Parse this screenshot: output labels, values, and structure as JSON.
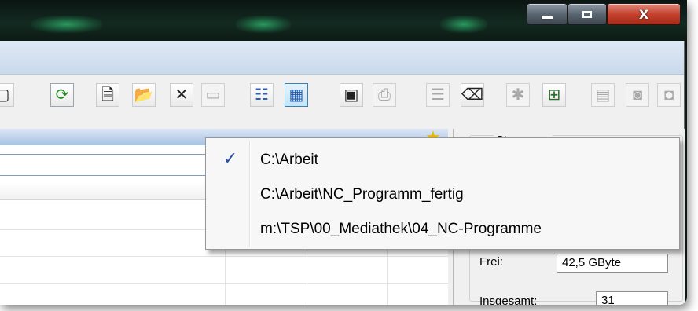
{
  "toolbar": {
    "buttons": [
      {
        "icon": "favorites-icon",
        "glyph": "▢",
        "state": "enabled"
      },
      {
        "icon": "refresh-icon",
        "glyph": "⟳",
        "state": "enabled"
      },
      {
        "icon": "new-file-icon",
        "glyph": "🗎",
        "state": "enabled"
      },
      {
        "icon": "open-folder-icon",
        "glyph": "📂",
        "state": "enabled"
      },
      {
        "icon": "delete-icon",
        "glyph": "✕",
        "state": "enabled"
      },
      {
        "icon": "rename-icon",
        "glyph": "▭",
        "state": "disabled"
      },
      {
        "icon": "list-view-icon",
        "glyph": "☷",
        "state": "enabled"
      },
      {
        "icon": "details-view-icon",
        "glyph": "▦",
        "state": "selected"
      },
      {
        "icon": "console-icon",
        "glyph": "▣",
        "state": "enabled"
      },
      {
        "icon": "print-icon",
        "glyph": "⎙",
        "state": "disabled"
      },
      {
        "icon": "document-list-icon",
        "glyph": "☰",
        "state": "disabled"
      },
      {
        "icon": "eraser-icon",
        "glyph": "⌫",
        "state": "enabled"
      },
      {
        "icon": "settings-icon",
        "glyph": "✱",
        "state": "disabled"
      },
      {
        "icon": "network-drive-icon",
        "glyph": "⊞",
        "state": "enabled"
      },
      {
        "icon": "panel-icon",
        "glyph": "▤",
        "state": "disabled"
      },
      {
        "icon": "camera-icon",
        "glyph": "◙",
        "state": "disabled"
      },
      {
        "icon": "camera2-icon",
        "glyph": "◘",
        "state": "disabled"
      }
    ]
  },
  "steuerung": {
    "title": "Steuerung",
    "free_label": "Frei:",
    "free_value": "42,5 GByte",
    "total_label": "Insgesamt:",
    "total_value": "31"
  },
  "popup_menu": {
    "items": [
      {
        "label": "C:\\Arbeit",
        "checked": true
      },
      {
        "label": "C:\\Arbeit\\NC_Programm_fertig",
        "checked": false
      },
      {
        "label": "m:\\TSP\\00_Mediathek\\04_NC-Programme",
        "checked": false
      }
    ],
    "check_glyph": "✓"
  },
  "colors": {
    "title_glow": "#2a9a5e",
    "close_button": "#c4432f",
    "checkmark": "#2250a8"
  }
}
